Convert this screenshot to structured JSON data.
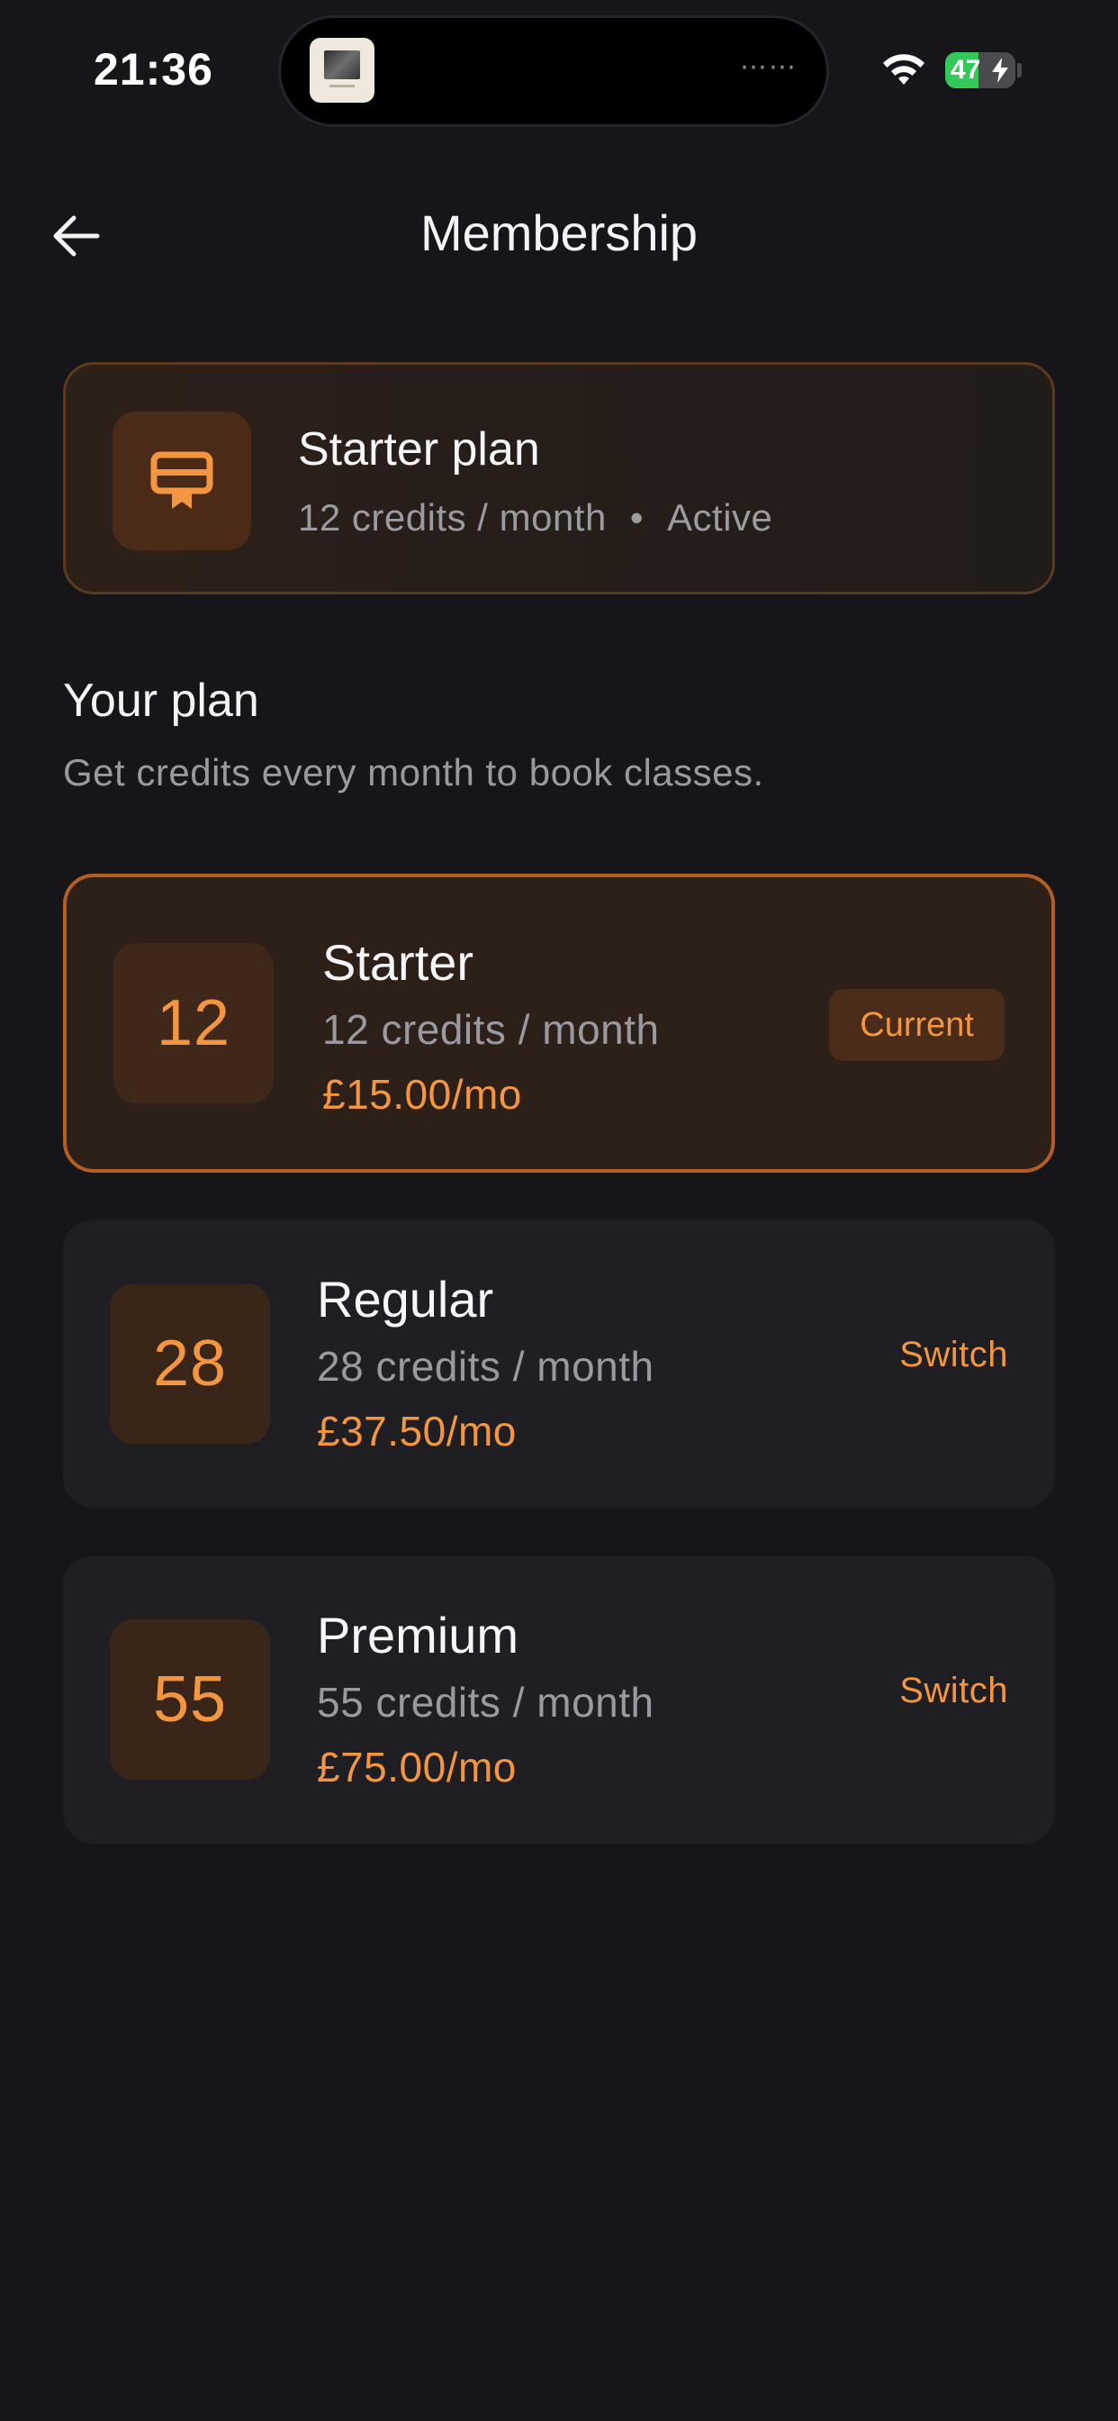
{
  "status_bar": {
    "time": "21:36",
    "battery_level": "47",
    "icons": [
      "wifi-icon",
      "battery-charging-icon"
    ]
  },
  "header": {
    "title": "Membership",
    "back_icon": "arrow-left-icon"
  },
  "active_plan": {
    "icon": "membership-card-icon",
    "title": "Starter plan",
    "credits": "12 credits / month",
    "separator": "•",
    "status": "Active"
  },
  "section": {
    "title": "Your plan",
    "subtitle": "Get credits every month to book classes."
  },
  "plans": [
    {
      "credit_count": "12",
      "name": "Starter",
      "credits": "12 credits / month",
      "price": "£15.00/mo",
      "action": "Current",
      "is_current": true
    },
    {
      "credit_count": "28",
      "name": "Regular",
      "credits": "28 credits / month",
      "price": "£37.50/mo",
      "action": "Switch",
      "is_current": false
    },
    {
      "credit_count": "55",
      "name": "Premium",
      "credits": "55 credits / month",
      "price": "£75.00/mo",
      "action": "Switch",
      "is_current": false
    }
  ],
  "colors": {
    "background": "#16151a",
    "accent": "#f4953f",
    "current_border": "#b45e22",
    "battery_green": "#34c759"
  }
}
